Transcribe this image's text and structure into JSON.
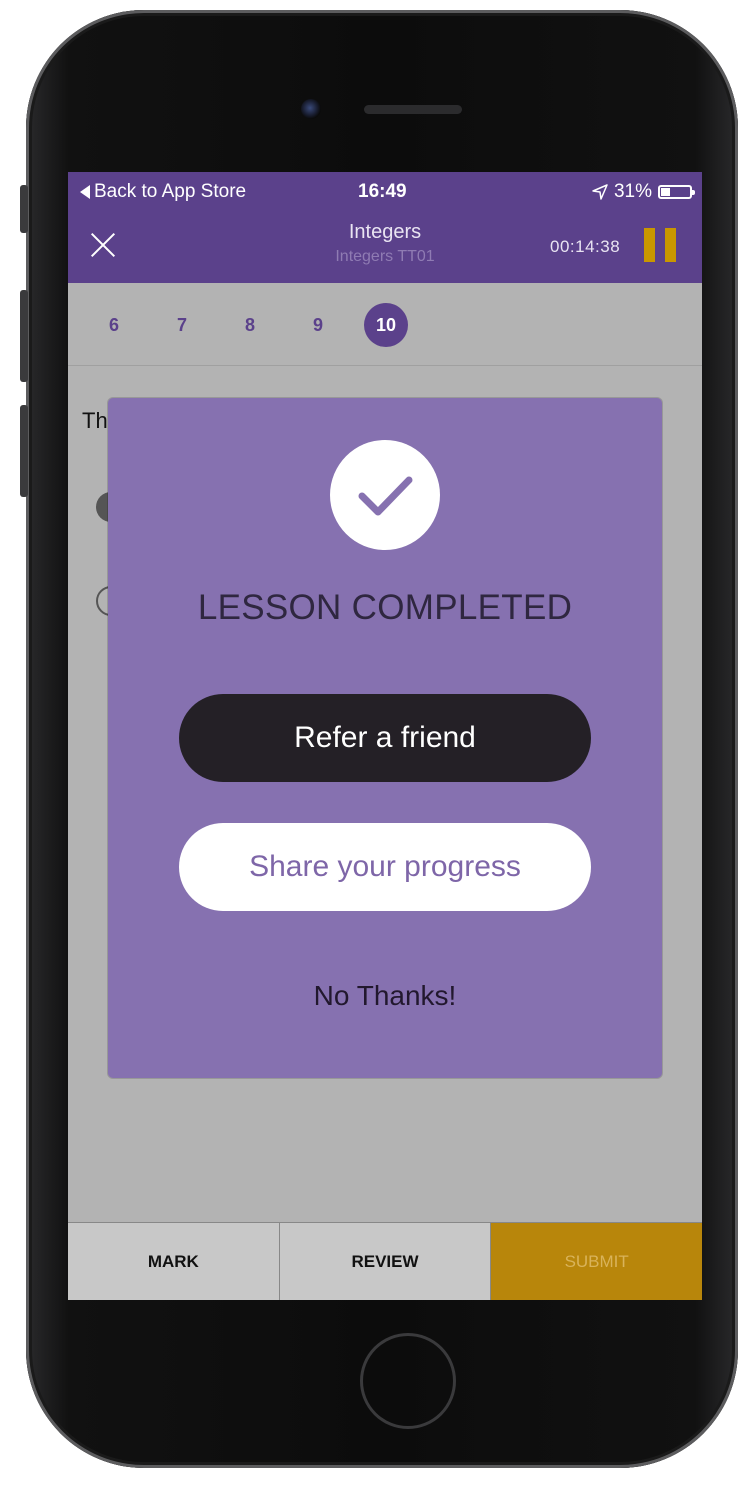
{
  "status_bar": {
    "back_label": "Back to App Store",
    "time": "16:49",
    "battery_percent": "31%",
    "battery_level": 0.31
  },
  "nav": {
    "title": "Integers",
    "subtitle": "Integers TT01",
    "timer": "00:14:38"
  },
  "question_numbers": [
    {
      "label": "6",
      "active": false
    },
    {
      "label": "7",
      "active": false
    },
    {
      "label": "8",
      "active": false
    },
    {
      "label": "9",
      "active": false
    },
    {
      "label": "10",
      "active": true
    }
  ],
  "question": {
    "text_visible": "Th"
  },
  "modal": {
    "title": "LESSON COMPLETED",
    "refer_label": "Refer a friend",
    "share_label": "Share your progress",
    "no_thanks_label": "No Thanks!"
  },
  "toolbar": {
    "mark_label": "MARK",
    "review_label": "REVIEW",
    "submit_label": "SUBMIT"
  },
  "colors": {
    "header": "#5b418b",
    "modal": "#8671b0",
    "accent": "#b8860b"
  }
}
